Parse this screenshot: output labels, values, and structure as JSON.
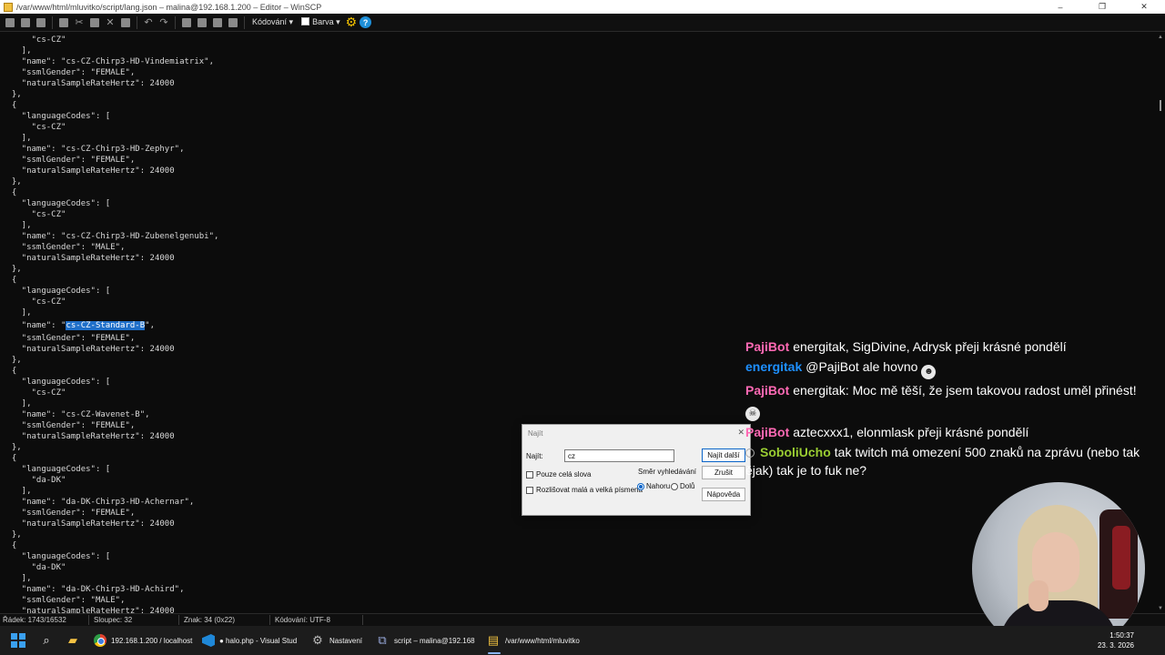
{
  "window": {
    "title": "/var/www/html/mluvitko/script/lang.json – malina@192.168.1.200 – Editor – WinSCP",
    "minimize": "–",
    "restore": "❐",
    "close": "✕"
  },
  "toolbar": {
    "encoding_label": "Kódování ▾",
    "color_label": "Barva ▾",
    "gear_icon": "⚙",
    "help_icon": "?"
  },
  "editor": {
    "lines_before": [
      "      \"cs-CZ\"",
      "    ],",
      "    \"name\": \"cs-CZ-Chirp3-HD-Vindemiatrix\",",
      "    \"ssmlGender\": \"FEMALE\",",
      "    \"naturalSampleRateHertz\": 24000",
      "  },",
      "  {",
      "    \"languageCodes\": [",
      "      \"cs-CZ\"",
      "    ],",
      "    \"name\": \"cs-CZ-Chirp3-HD-Zephyr\",",
      "    \"ssmlGender\": \"FEMALE\",",
      "    \"naturalSampleRateHertz\": 24000",
      "  },",
      "  {",
      "    \"languageCodes\": [",
      "      \"cs-CZ\"",
      "    ],",
      "    \"name\": \"cs-CZ-Chirp3-HD-Zubenelgenubi\",",
      "    \"ssmlGender\": \"MALE\",",
      "    \"naturalSampleRateHertz\": 24000",
      "  },",
      "  {",
      "    \"languageCodes\": [",
      "      \"cs-CZ\"",
      "    ],"
    ],
    "highlight_prefix": "    \"name\": \"",
    "highlight_text": "cs-CZ-Standard-B",
    "highlight_suffix": "\",",
    "lines_after": [
      "    \"ssmlGender\": \"FEMALE\",",
      "    \"naturalSampleRateHertz\": 24000",
      "  },",
      "  {",
      "    \"languageCodes\": [",
      "      \"cs-CZ\"",
      "    ],",
      "    \"name\": \"cs-CZ-Wavenet-B\",",
      "    \"ssmlGender\": \"FEMALE\",",
      "    \"naturalSampleRateHertz\": 24000",
      "  },",
      "  {",
      "    \"languageCodes\": [",
      "      \"da-DK\"",
      "    ],",
      "    \"name\": \"da-DK-Chirp3-HD-Achernar\",",
      "    \"ssmlGender\": \"FEMALE\",",
      "    \"naturalSampleRateHertz\": 24000",
      "  },",
      "  {",
      "    \"languageCodes\": [",
      "      \"da-DK\"",
      "    ],",
      "    \"name\": \"da-DK-Chirp3-HD-Achird\",",
      "    \"ssmlGender\": \"MALE\",",
      "    \"naturalSampleRateHertz\": 24000"
    ]
  },
  "status": {
    "line": "Řádek: 1743/16532",
    "column": "Sloupec: 32",
    "char": "Znak: 34 (0x22)",
    "encoding": "Kódování: UTF-8"
  },
  "find_dialog": {
    "title": "Najít",
    "find_label": "Najít:",
    "find_value": "cz",
    "whole_words": "Pouze celá slova",
    "match_case": "Rozlišovat malá a velká písmena",
    "direction_label": "Směr vyhledávání",
    "dir_up": "Nahoru",
    "dir_down": "Dolů",
    "find_next": "Najít další",
    "cancel": "Zrušit",
    "help": "Nápověda"
  },
  "chat": {
    "messages": [
      {
        "user": "PajiBot",
        "color": "#ff69b4",
        "text": "energitak, SigDivine, Adrysk přeji krásné pondělí",
        "emote": ""
      },
      {
        "user": "energitak",
        "color": "#1e90ff",
        "text": "@PajiBot ale hovno",
        "emote": "☻"
      },
      {
        "user": "PajiBot",
        "color": "#ff69b4",
        "text": "energitak: Moc mě těší, že jsem takovou radost uměl přinést!",
        "emote": "☠"
      },
      {
        "user": "PajiBot",
        "color": "#ff69b4",
        "text": "aztecxxx1, elonmlask přeji krásné pondělí",
        "emote": ""
      },
      {
        "user": "SoboliUcho",
        "color": "#9acd32",
        "text": "tak twitch má omezení 500 znaků na zprávu (nebo tak ějak) tak je to fuk ne?",
        "emote": ""
      }
    ]
  },
  "taskbar": {
    "chrome_label": "192.168.1.200 / localhost",
    "vscode_label": "● halo.php - Visual Stud",
    "settings_label": "Nastavení",
    "winscp_label": "script – malina@192.168",
    "editor_label": "/var/www/html/mluvitko",
    "time": "1:50:37",
    "date": "23. 3. 2026"
  }
}
